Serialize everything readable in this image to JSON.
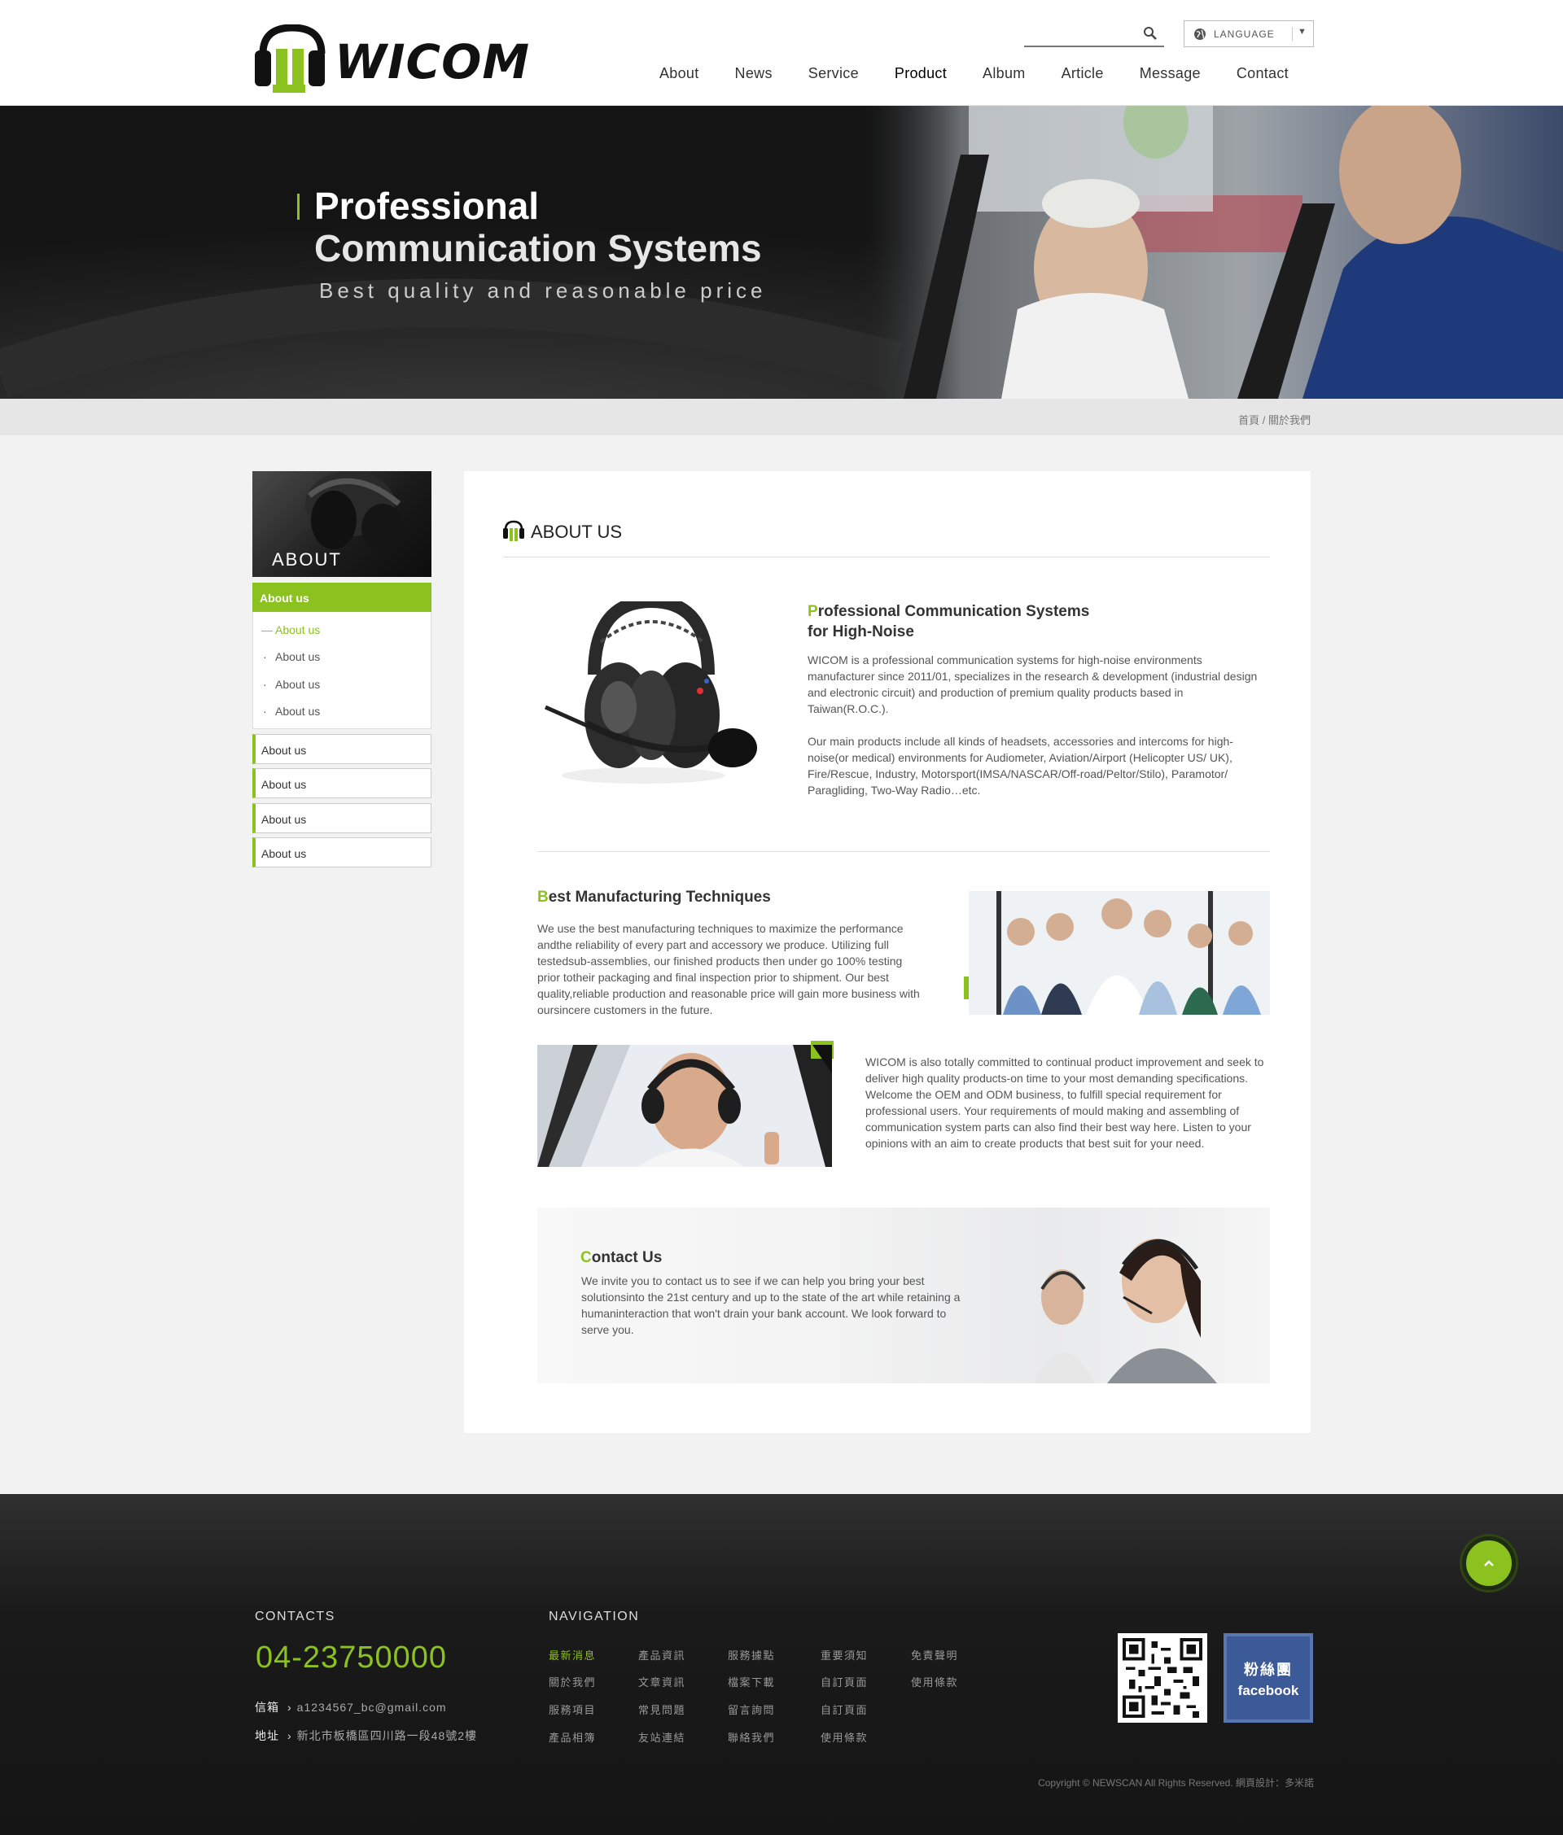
{
  "header": {
    "logo_text": "WICOM",
    "search": {
      "placeholder": ""
    },
    "language_label": "LANGUAGE",
    "nav": [
      "About",
      "News",
      "Service",
      "Product",
      "Album",
      "Article",
      "Message",
      "Contact"
    ]
  },
  "banner": {
    "title_line1": "Professional",
    "title_line2": "Communication Systems",
    "subtitle": "Best quality and reasonable price"
  },
  "breadcrumb": "首頁 / 關於我們",
  "sidebar": {
    "image_title": "ABOUT",
    "active": "About us",
    "sub_items": [
      "About us",
      "About us",
      "About us",
      "About us"
    ],
    "boxes": [
      "About us",
      "About us",
      "About us",
      "About us"
    ]
  },
  "content": {
    "title": "ABOUT US",
    "sec1": {
      "heading_first": "P",
      "heading_rest": "rofessional Communication Systems",
      "heading_line2": "for High-Noise",
      "para1": "WICOM is a professional communication systems for high-noise environments manufacturer since 2011/01, specializes in the research & development (industrial design and electronic circuit) and production of premium quality products based in Taiwan(R.O.C.).",
      "para2": "Our main products include all kinds of headsets, accessories and intercoms for high-noise(or medical) environments for Audiometer, Aviation/Airport  (Helicopter US/ UK), Fire/Rescue, Industry, Motorsport(IMSA/NASCAR/Off-road/Peltor/Stilo), Paramotor/ Paragliding, Two-Way Radio…etc."
    },
    "sec2": {
      "heading_first": "B",
      "heading_rest": "est Manufacturing Techniques",
      "para": "We use the best manufacturing techniques to maximize the performance andthe reliability of every part and accessory we produce. Utilizing full testedsub-assemblies, our finished products then under go 100% testing prior totheir packaging and final inspection prior to shipment. Our best quality,reliable production and reasonable price will gain more business with oursincere customers in the future."
    },
    "sec3": {
      "para": "WICOM is also totally committed to continual product improvement and seek to deliver high quality products-on time to your most demanding specifications. Welcome the OEM and ODM business, to fulfill special requirement for professional users. Your requirements of mould making and assembling of communication system parts can also find their best way here. Listen to your opinions with an aim to create products that best suit for your need."
    },
    "contact": {
      "heading_first": "C",
      "heading_rest": "ontact Us",
      "para": "We invite you to contact us to see if we can help you bring your best solutionsinto the 21st century and up to the state of the art while retaining a humaninteraction that won't drain your bank account. We look forward to serve you."
    }
  },
  "footer": {
    "contacts_heading": "CONTACTS",
    "phone": "04-23750000",
    "email_label": "信箱",
    "email": "a1234567_bc@gmail.com",
    "address_label": "地址",
    "address": "新北市板橋區四川路一段48號2樓",
    "nav_heading": "NAVIGATION",
    "nav_columns": [
      [
        "最新消息",
        "關於我們",
        "服務項目",
        "產品相簿"
      ],
      [
        "產品資訊",
        "文章資訊",
        "常見問題",
        "友站連結"
      ],
      [
        "服務據點",
        "檔案下載",
        "留言詢問",
        "聯絡我們"
      ],
      [
        "重要須知",
        "自訂頁面",
        "自訂頁面",
        "使用條款"
      ],
      [
        "免責聲明",
        "使用條款"
      ]
    ],
    "facebook_label_cn": "粉絲團",
    "facebook_label_en": "facebook",
    "copyright": "Copyright © NEWSCAN All Rights Reserved. 網頁設計：多米諾"
  },
  "colors": {
    "accent": "#8bc21f",
    "footer_bg": "#1a1a1a",
    "facebook": "#3d5a98"
  },
  "icons": [
    "headset-logo-icon",
    "search-icon",
    "globe-icon",
    "caret-down-icon",
    "headset-title-icon",
    "chevron-up-icon",
    "qr-code-icon"
  ]
}
